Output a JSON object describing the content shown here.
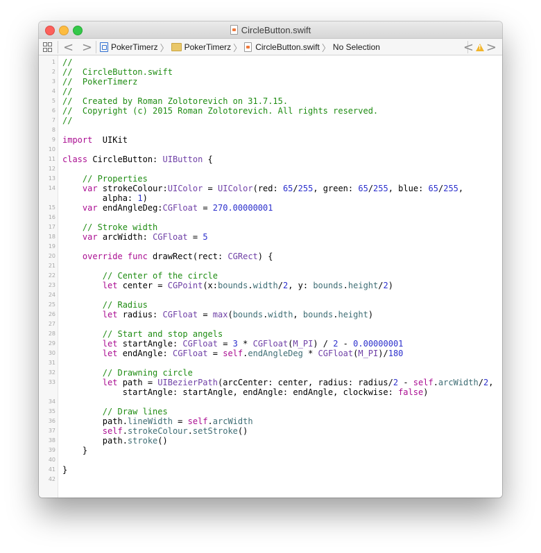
{
  "window": {
    "title": "CircleButton.swift"
  },
  "jumpbar": {
    "back": "<",
    "forward": ">",
    "crumbs": [
      {
        "label": "PokerTimerz",
        "icon": "project-icon"
      },
      {
        "label": "PokerTimerz",
        "icon": "folder-icon"
      },
      {
        "label": "CircleButton.swift",
        "icon": "swift-file-icon"
      },
      {
        "label": "No Selection",
        "icon": ""
      }
    ],
    "issue_prev": "<",
    "issue_next": ">"
  },
  "colors": {
    "comment": "#1f8c13",
    "keyword": "#aa0d91",
    "type": "#6f40a6",
    "number": "#2b2fcc",
    "property": "#3e6d74"
  },
  "code": [
    {
      "n": "1",
      "tokens": [
        [
          "c",
          "//"
        ]
      ]
    },
    {
      "n": "2",
      "tokens": [
        [
          "c",
          "//  CircleButton.swift"
        ]
      ]
    },
    {
      "n": "3",
      "tokens": [
        [
          "c",
          "//  PokerTimerz"
        ]
      ]
    },
    {
      "n": "4",
      "tokens": [
        [
          "c",
          "//"
        ]
      ]
    },
    {
      "n": "5",
      "tokens": [
        [
          "c",
          "//  Created by Roman Zolotorevich on 31.7.15."
        ]
      ]
    },
    {
      "n": "6",
      "tokens": [
        [
          "c",
          "//  Copyright (c) 2015 Roman Zolotorevich. All rights reserved."
        ]
      ]
    },
    {
      "n": "7",
      "tokens": [
        [
          "c",
          "//"
        ]
      ]
    },
    {
      "n": "8",
      "tokens": []
    },
    {
      "n": "9",
      "tokens": [
        [
          "k",
          "import"
        ],
        [
          "",
          "  UIKit"
        ]
      ]
    },
    {
      "n": "10",
      "tokens": []
    },
    {
      "n": "11",
      "tokens": [
        [
          "k",
          "class"
        ],
        [
          "",
          " CircleButton: "
        ],
        [
          "t",
          "UIButton"
        ],
        [
          "",
          " {"
        ]
      ]
    },
    {
      "n": "12",
      "tokens": []
    },
    {
      "n": "13",
      "tokens": [
        [
          "",
          "    "
        ],
        [
          "c",
          "// Properties"
        ]
      ]
    },
    {
      "n": "14",
      "wrap": true,
      "tokens": [
        [
          "",
          "    "
        ],
        [
          "k",
          "var"
        ],
        [
          "",
          " strokeColour:"
        ],
        [
          "t",
          "UIColor"
        ],
        [
          "",
          " = "
        ],
        [
          "t",
          "UIColor"
        ],
        [
          "",
          "(red: "
        ],
        [
          "n",
          "65"
        ],
        [
          "",
          "/"
        ],
        [
          "n",
          "255"
        ],
        [
          "",
          ", green: "
        ],
        [
          "n",
          "65"
        ],
        [
          "",
          "/"
        ],
        [
          "n",
          "255"
        ],
        [
          "",
          ", blue: "
        ],
        [
          "n",
          "65"
        ],
        [
          "",
          "/"
        ],
        [
          "n",
          "255"
        ],
        [
          "",
          ",\n        alpha: "
        ],
        [
          "n",
          "1"
        ],
        [
          "",
          ")"
        ]
      ]
    },
    {
      "n": "15",
      "tokens": [
        [
          "",
          "    "
        ],
        [
          "k",
          "var"
        ],
        [
          "",
          " endAngleDeg:"
        ],
        [
          "t",
          "CGFloat"
        ],
        [
          "",
          " = "
        ],
        [
          "n",
          "270.00000001"
        ]
      ]
    },
    {
      "n": "16",
      "tokens": []
    },
    {
      "n": "17",
      "tokens": [
        [
          "",
          "    "
        ],
        [
          "c",
          "// Stroke width"
        ]
      ]
    },
    {
      "n": "18",
      "tokens": [
        [
          "",
          "    "
        ],
        [
          "k",
          "var"
        ],
        [
          "",
          " arcWidth: "
        ],
        [
          "t",
          "CGFloat"
        ],
        [
          "",
          " = "
        ],
        [
          "n",
          "5"
        ]
      ]
    },
    {
      "n": "19",
      "tokens": []
    },
    {
      "n": "20",
      "tokens": [
        [
          "",
          "    "
        ],
        [
          "k",
          "override func"
        ],
        [
          "",
          " drawRect(rect: "
        ],
        [
          "t",
          "CGRect"
        ],
        [
          "",
          ") {"
        ]
      ]
    },
    {
      "n": "21",
      "tokens": []
    },
    {
      "n": "22",
      "tokens": [
        [
          "",
          "        "
        ],
        [
          "c",
          "// Center of the circle"
        ]
      ]
    },
    {
      "n": "23",
      "tokens": [
        [
          "",
          "        "
        ],
        [
          "k",
          "let"
        ],
        [
          "",
          " center = "
        ],
        [
          "t",
          "CGPoint"
        ],
        [
          "",
          "(x:"
        ],
        [
          "p",
          "bounds"
        ],
        [
          "",
          "."
        ],
        [
          "p",
          "width"
        ],
        [
          "",
          "/"
        ],
        [
          "n",
          "2"
        ],
        [
          "",
          ", y: "
        ],
        [
          "p",
          "bounds"
        ],
        [
          "",
          "."
        ],
        [
          "p",
          "height"
        ],
        [
          "",
          "/"
        ],
        [
          "n",
          "2"
        ],
        [
          "",
          ")"
        ]
      ]
    },
    {
      "n": "24",
      "tokens": []
    },
    {
      "n": "25",
      "tokens": [
        [
          "",
          "        "
        ],
        [
          "c",
          "// Radius"
        ]
      ]
    },
    {
      "n": "26",
      "tokens": [
        [
          "",
          "        "
        ],
        [
          "k",
          "let"
        ],
        [
          "",
          " radius: "
        ],
        [
          "t",
          "CGFloat"
        ],
        [
          "",
          " = "
        ],
        [
          "t",
          "max"
        ],
        [
          "",
          "("
        ],
        [
          "p",
          "bounds"
        ],
        [
          "",
          "."
        ],
        [
          "p",
          "width"
        ],
        [
          "",
          ", "
        ],
        [
          "p",
          "bounds"
        ],
        [
          "",
          "."
        ],
        [
          "p",
          "height"
        ],
        [
          "",
          ")"
        ]
      ]
    },
    {
      "n": "27",
      "tokens": []
    },
    {
      "n": "28",
      "tokens": [
        [
          "",
          "        "
        ],
        [
          "c",
          "// Start and stop angels"
        ]
      ]
    },
    {
      "n": "29",
      "tokens": [
        [
          "",
          "        "
        ],
        [
          "k",
          "let"
        ],
        [
          "",
          " startAngle: "
        ],
        [
          "t",
          "CGFloat"
        ],
        [
          "",
          " = "
        ],
        [
          "n",
          "3"
        ],
        [
          "",
          " * "
        ],
        [
          "t",
          "CGFloat"
        ],
        [
          "",
          "("
        ],
        [
          "t",
          "M_PI"
        ],
        [
          "",
          ") / "
        ],
        [
          "n",
          "2"
        ],
        [
          "",
          " - "
        ],
        [
          "n",
          "0.00000001"
        ]
      ]
    },
    {
      "n": "30",
      "tokens": [
        [
          "",
          "        "
        ],
        [
          "k",
          "let"
        ],
        [
          "",
          " endAngle: "
        ],
        [
          "t",
          "CGFloat"
        ],
        [
          "",
          " = "
        ],
        [
          "k",
          "self"
        ],
        [
          "",
          "."
        ],
        [
          "p",
          "endAngleDeg"
        ],
        [
          "",
          " * "
        ],
        [
          "t",
          "CGFloat"
        ],
        [
          "",
          "("
        ],
        [
          "t",
          "M_PI"
        ],
        [
          "",
          ")/"
        ],
        [
          "n",
          "180"
        ]
      ]
    },
    {
      "n": "31",
      "tokens": []
    },
    {
      "n": "32",
      "tokens": [
        [
          "",
          "        "
        ],
        [
          "c",
          "// Drawning circle"
        ]
      ]
    },
    {
      "n": "33",
      "wrap": true,
      "tokens": [
        [
          "",
          "        "
        ],
        [
          "k",
          "let"
        ],
        [
          "",
          " path = "
        ],
        [
          "t",
          "UIBezierPath"
        ],
        [
          "",
          "(arcCenter: center, radius: radius/"
        ],
        [
          "n",
          "2"
        ],
        [
          "",
          " - "
        ],
        [
          "k",
          "self"
        ],
        [
          "",
          "."
        ],
        [
          "p",
          "arcWidth"
        ],
        [
          "",
          "/"
        ],
        [
          "n",
          "2"
        ],
        [
          "",
          ",\n            startAngle: startAngle, endAngle: endAngle, clockwise: "
        ],
        [
          "k",
          "false"
        ],
        [
          "",
          ")"
        ]
      ]
    },
    {
      "n": "34",
      "tokens": []
    },
    {
      "n": "35",
      "tokens": [
        [
          "",
          "        "
        ],
        [
          "c",
          "// Draw lines"
        ]
      ]
    },
    {
      "n": "36",
      "tokens": [
        [
          "",
          "        path."
        ],
        [
          "p",
          "lineWidth"
        ],
        [
          "",
          " = "
        ],
        [
          "k",
          "self"
        ],
        [
          "",
          "."
        ],
        [
          "p",
          "arcWidth"
        ]
      ]
    },
    {
      "n": "37",
      "tokens": [
        [
          "",
          "        "
        ],
        [
          "k",
          "self"
        ],
        [
          "",
          "."
        ],
        [
          "p",
          "strokeColour"
        ],
        [
          "",
          "."
        ],
        [
          "p",
          "setStroke"
        ],
        [
          "",
          "()"
        ]
      ]
    },
    {
      "n": "38",
      "tokens": [
        [
          "",
          "        path."
        ],
        [
          "p",
          "stroke"
        ],
        [
          "",
          "()"
        ]
      ]
    },
    {
      "n": "39",
      "tokens": [
        [
          "",
          "    }"
        ]
      ]
    },
    {
      "n": "40",
      "tokens": []
    },
    {
      "n": "41",
      "tokens": [
        [
          "",
          "}"
        ]
      ]
    },
    {
      "n": "42",
      "tokens": []
    }
  ]
}
